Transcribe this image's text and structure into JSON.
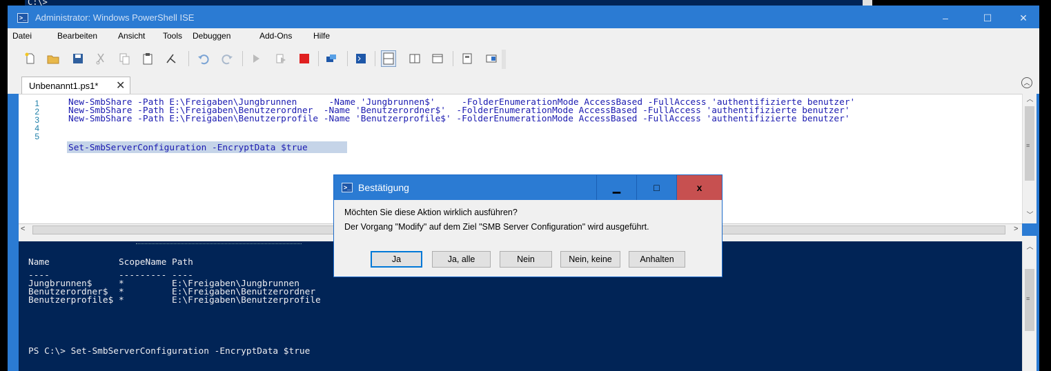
{
  "background": {
    "prompt_text": "C:\\>"
  },
  "window": {
    "title": "Administrator: Windows PowerShell ISE",
    "controls": {
      "minimize": "‒",
      "maximize": "☐",
      "close": "✕"
    },
    "accent_color": "#2b7bd3"
  },
  "menu": [
    "Datei",
    "Bearbeiten",
    "Ansicht",
    "Tools",
    "Debuggen",
    "Add-Ons",
    "Hilfe"
  ],
  "toolbar": {
    "icons": [
      "new-file-icon",
      "open-folder-icon",
      "save-icon",
      "cut-icon",
      "copy-icon",
      "paste-icon",
      "clear-icon",
      "undo-icon",
      "redo-icon",
      "run-script-icon",
      "run-selection-icon",
      "stop-icon",
      "remote-powershell-icon",
      "powershell-console-icon",
      "show-script-pane-top-icon",
      "show-script-pane-right-icon",
      "show-script-pane-maximized-icon",
      "show-command-window-icon",
      "show-command-addon-icon"
    ]
  },
  "tab": {
    "label": "Unbenannt1.ps1*",
    "close": "✕"
  },
  "editor": {
    "lines": [
      {
        "num": "1",
        "text": "New-SmbShare -Path E:\\Freigaben\\Jungbrunnen      -Name 'Jungbrunnen$'     -FolderEnumerationMode AccessBased -FullAccess 'authentifizierte benutzer'"
      },
      {
        "num": "2",
        "text": "New-SmbShare -Path E:\\Freigaben\\Benutzerordner  -Name 'Benutzerordner$'  -FolderEnumerationMode AccessBased -FullAccess 'authentifizierte benutzer'"
      },
      {
        "num": "3",
        "text": "New-SmbShare -Path E:\\Freigaben\\Benutzerprofile -Name 'Benutzerprofile$' -FolderEnumerationMode AccessBased -FullAccess 'authentifizierte benutzer'"
      },
      {
        "num": "4",
        "text": ""
      },
      {
        "num": "5",
        "text": "Set-SmbServerConfiguration -EncryptData $true"
      }
    ]
  },
  "console": {
    "header": "Name             ScopeName Path",
    "underline": "----             --------- ----",
    "rows": [
      "Jungbrunnen$     *         E:\\Freigaben\\Jungbrunnen",
      "Benutzerordner$  *         E:\\Freigaben\\Benutzerordner",
      "Benutzerprofile$ *         E:\\Freigaben\\Benutzerprofile"
    ],
    "prompt_line": "PS C:\\> Set-SmbServerConfiguration -EncryptData $true",
    "background_color": "#012456"
  },
  "dialog": {
    "title": "Bestätigung",
    "message_line1": "Möchten Sie diese Aktion wirklich ausführen?",
    "message_line2": "Der Vorgang \"Modify\" auf dem Ziel \"SMB Server Configuration\" wird ausgeführt.",
    "buttons": {
      "yes": "Ja",
      "yes_all": "Ja, alle",
      "no": "Nein",
      "no_all": "Nein, keine",
      "suspend": "Anhalten"
    },
    "controls": {
      "minimize": "▁",
      "maximize": "□",
      "close": "x"
    }
  }
}
